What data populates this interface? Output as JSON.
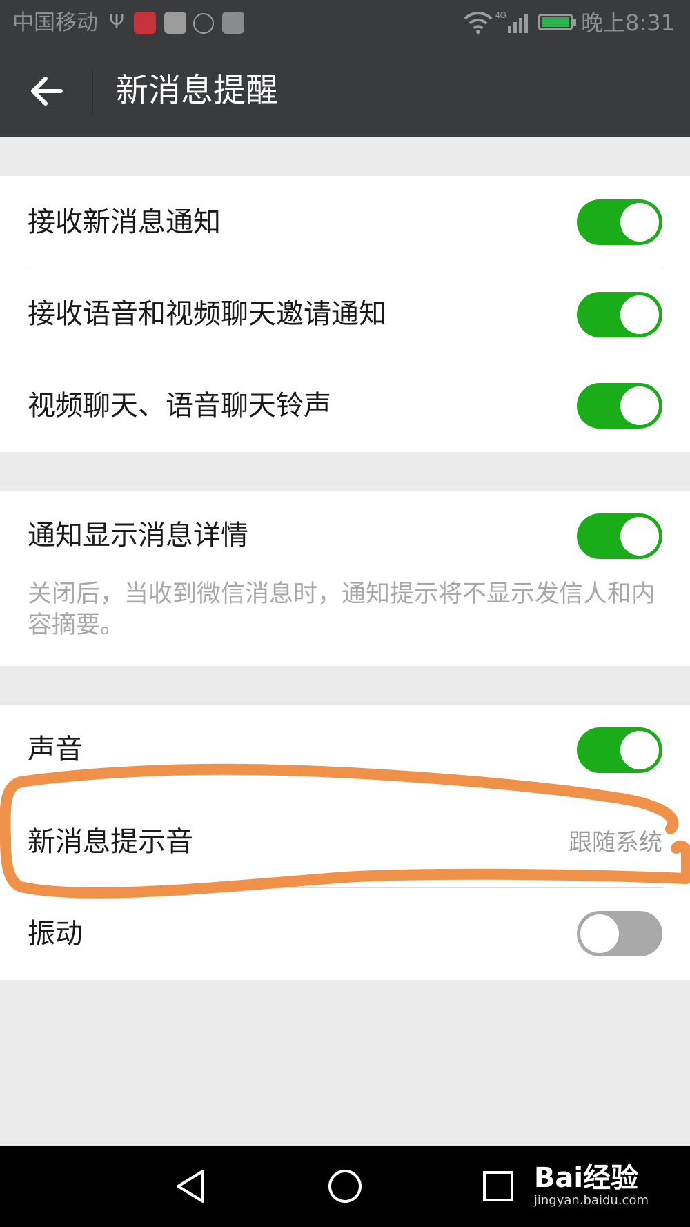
{
  "status_bar": {
    "carrier": "中国移动",
    "network": "4G",
    "time": "晚上8:31",
    "icons": [
      "usb-icon",
      "app-icon-red",
      "sina-icon",
      "hand-icon",
      "app-icon-grey",
      "wifi-icon",
      "signal-icon",
      "battery-icon"
    ]
  },
  "header": {
    "back_icon": "back-arrow-icon",
    "title": "新消息提醒"
  },
  "groups": [
    {
      "rows": [
        {
          "label": "接收新消息通知",
          "toggle": true
        },
        {
          "label": "接收语音和视频聊天邀请通知",
          "toggle": true
        },
        {
          "label": "视频聊天、语音聊天铃声",
          "toggle": true
        }
      ]
    },
    {
      "rows": [
        {
          "label": "通知显示消息详情",
          "toggle": true,
          "description": "关闭后，当收到微信消息时，通知提示将不显示发信人和内容摘要。"
        }
      ]
    },
    {
      "rows": [
        {
          "label": "声音",
          "toggle": true
        },
        {
          "label": "新消息提示音",
          "value": "跟随系统"
        },
        {
          "label": "振动",
          "toggle": false
        }
      ]
    }
  ],
  "annotation": {
    "color": "#f0914a",
    "target": "新消息提示音"
  },
  "nav_bar": {
    "buttons": [
      "back-triangle-icon",
      "home-circle-icon",
      "recents-square-icon"
    ]
  },
  "watermark": {
    "main": "Bai经验",
    "sub": "jingyan.baidu.com"
  },
  "colors": {
    "toggle_on": "#1aad19",
    "toggle_off": "#a9a9a9",
    "header": "#3a3b3d",
    "background": "#ebebeb"
  }
}
